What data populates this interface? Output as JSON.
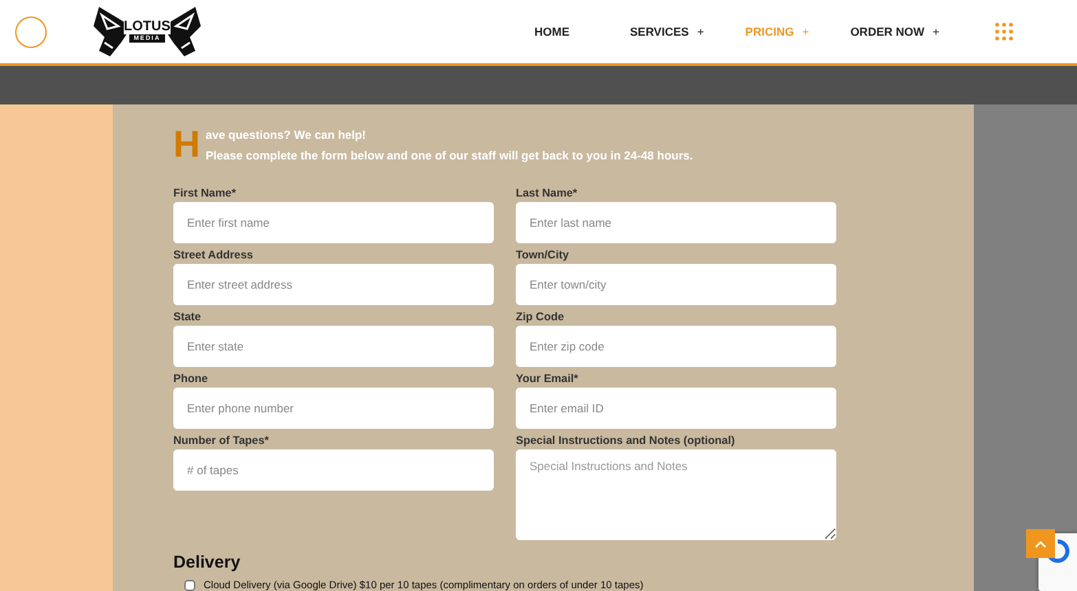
{
  "logo": {
    "top": "LOTUS",
    "bottom": "MEDIA"
  },
  "nav": [
    {
      "label": "HOME",
      "selected": false
    },
    {
      "label": "SERVICES",
      "submenu_mark": "+",
      "selected": false
    },
    {
      "label": "PRICING",
      "submenu_mark": "+",
      "selected": true
    },
    {
      "label": "ORDER NOW",
      "submenu_mark": "+",
      "selected": false
    }
  ],
  "intro": {
    "drop_cap": "H",
    "lines": [
      "ave questions? We can help!",
      "Please complete the form below and one of our staff will get back to you in 24-48 hours."
    ]
  },
  "fields": [
    {
      "label": "First Name*",
      "placeholder": "Enter first name",
      "kind": "input"
    },
    {
      "label": "Last Name*",
      "placeholder": "Enter last name",
      "kind": "input"
    },
    {
      "label": "Street Address",
      "placeholder": "Enter street address",
      "kind": "input"
    },
    {
      "label": "Town/City",
      "placeholder": "Enter town/city",
      "kind": "input"
    },
    {
      "label": "State",
      "placeholder": "Enter state",
      "kind": "input"
    },
    {
      "label": "Zip Code",
      "placeholder": "Enter zip code",
      "kind": "input"
    },
    {
      "label": "Phone",
      "placeholder": "Enter phone number",
      "kind": "input"
    },
    {
      "label": "Your Email*",
      "placeholder": "Enter email ID",
      "kind": "input"
    },
    {
      "label": "Number of Tapes*",
      "placeholder": "# of tapes",
      "kind": "input"
    },
    {
      "label": "Special Instructions and Notes (optional)",
      "placeholder": "Special Instructions and Notes",
      "kind": "textarea"
    }
  ],
  "delivery": {
    "title": "Delivery",
    "options": [
      {
        "label": "Cloud Delivery (via Google Drive) $10 per 10 tapes (complimentary on orders of under 10 tapes)",
        "checked": false
      }
    ]
  }
}
